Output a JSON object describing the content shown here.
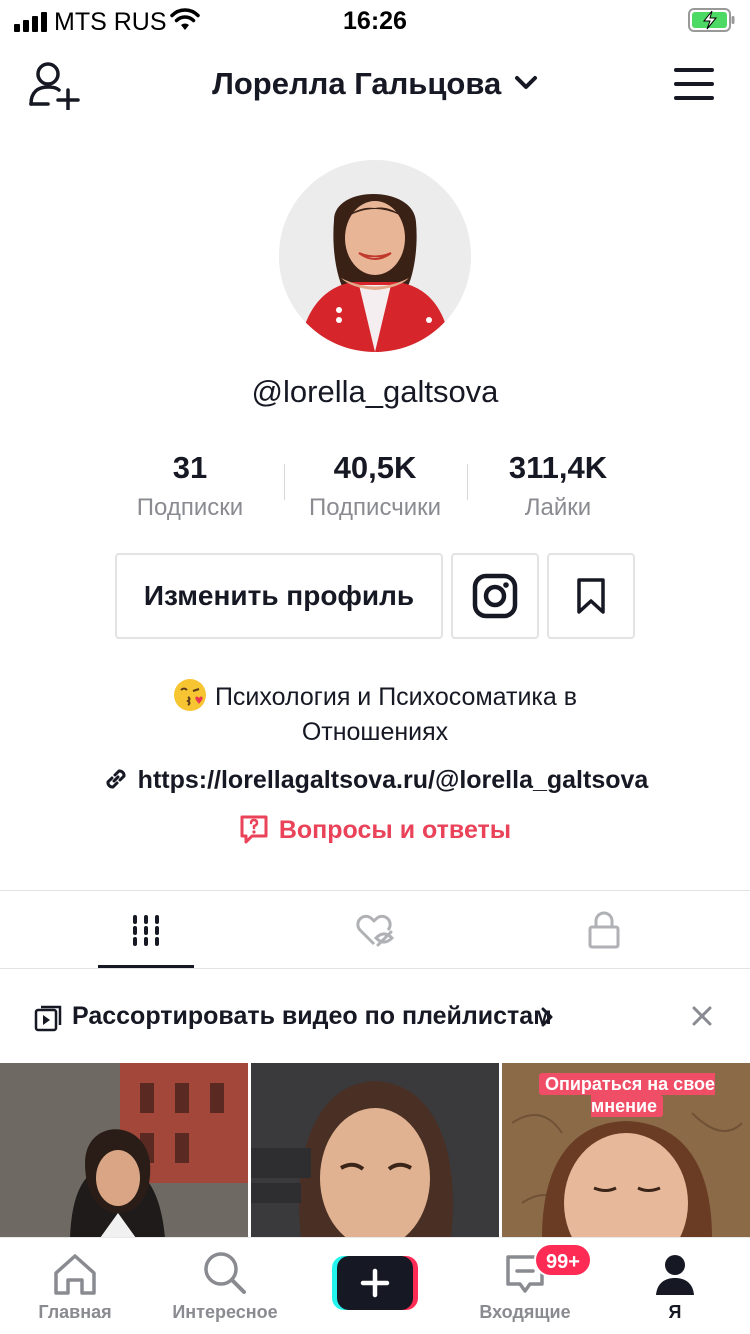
{
  "status_bar": {
    "carrier": "MTS RUS",
    "time": "16:26"
  },
  "header": {
    "title": "Лорелла Гальцова",
    "add_user_icon": "person-plus-icon",
    "menu_icon": "hamburger-menu-icon"
  },
  "profile": {
    "username": "@lorella_galtsova",
    "stats": [
      {
        "value": "31",
        "label": "Подписки"
      },
      {
        "value": "40,5K",
        "label": "Подписчики"
      },
      {
        "value": "311,4K",
        "label": "Лайки"
      }
    ],
    "edit_button": "Изменить профиль",
    "bio_line1": "Психология  и Психосоматика в",
    "bio_line2": "Отношениях",
    "link": "https://lorellagaltsova.ru/@lorella_galtsova",
    "qa_label": "Вопросы и ответы"
  },
  "tabs": [
    "videos-grid-icon",
    "liked-hidden-icon",
    "private-lock-icon"
  ],
  "playlist_banner": {
    "text": "Рассортировать видео по плейлистам"
  },
  "videos": [
    {
      "caption": ""
    },
    {
      "caption": ""
    },
    {
      "caption": "Опираться на свое мнение"
    }
  ],
  "tabbar": {
    "home": "Главная",
    "discover": "Интересное",
    "inbox": "Входящие",
    "inbox_badge": "99+",
    "me": "Я"
  },
  "colors": {
    "accent": "#ea4359",
    "badge": "#fe2c55",
    "text": "#161823",
    "secondary": "#8a8b91"
  }
}
